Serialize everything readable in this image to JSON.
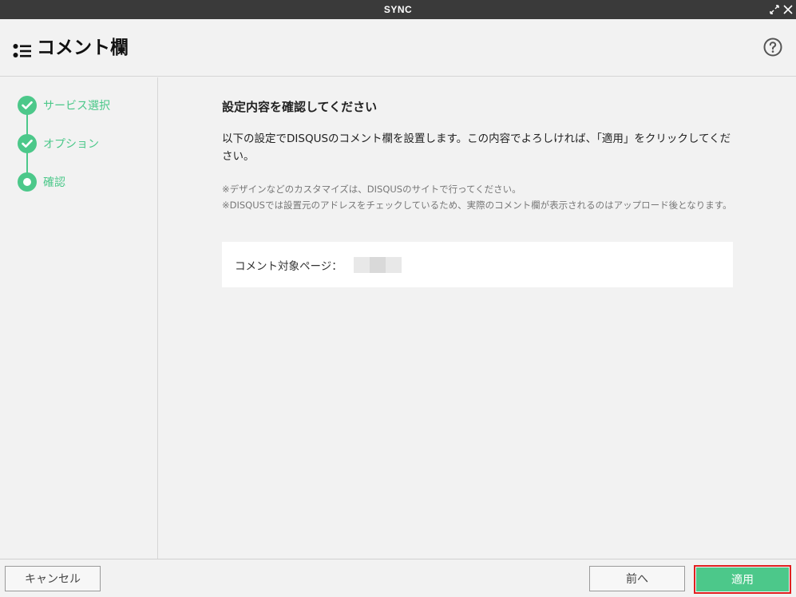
{
  "window": {
    "title": "SYNC",
    "controls": {
      "expand_icon": "expand-icon",
      "close_icon": "close-icon"
    }
  },
  "header": {
    "title": "コメント欄",
    "icon": "list-icon",
    "help_icon": "help-icon"
  },
  "steps": [
    {
      "label": "サービス選択",
      "status": "done"
    },
    {
      "label": "オプション",
      "status": "done"
    },
    {
      "label": "確認",
      "status": "current"
    }
  ],
  "main": {
    "heading": "設定内容を確認してください",
    "description": "以下の設定でDISQUSのコメント欄を設置します。この内容でよろしければ、「適用」をクリックしてください。",
    "notes": [
      "※デザインなどのカスタマイズは、DISQUSのサイトで行ってください。",
      "※DISQUSでは設置元のアドレスをチェックしているため、実際のコメント欄が表示されるのはアップロード後となります。"
    ],
    "summary": {
      "label": "コメント対象ページ："
    }
  },
  "footer": {
    "cancel_label": "キャンセル",
    "prev_label": "前へ",
    "apply_label": "適用"
  },
  "colors": {
    "accent": "#4cc88a",
    "titlebar": "#3a3a3a",
    "highlight_border": "#e02020"
  }
}
